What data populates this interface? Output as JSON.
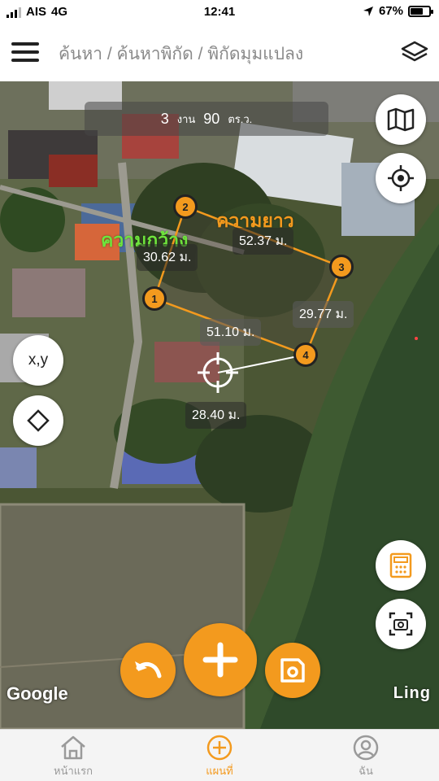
{
  "status_bar": {
    "carrier": "AIS",
    "network": "4G",
    "time": "12:41",
    "battery": "67%"
  },
  "header": {
    "breadcrumb": "ค้นหา / ค้นหาพิกัด / พิกัดมุมแปลง"
  },
  "map": {
    "area": {
      "value1": "3",
      "unit1": "งาน",
      "value2": "90",
      "unit2": "ตร.ว."
    },
    "length_title": "ความยาว",
    "width_title": "ความกว้าง",
    "edges": {
      "e23": "52.37 ม.",
      "e12": "30.62 ม.",
      "e34": "29.77 ม.",
      "e14": "51.10 ม.",
      "cursor": "28.40 ม."
    },
    "points": [
      "1",
      "2",
      "3",
      "4"
    ],
    "xy_button": "x,y",
    "attribution": "Google",
    "watermark": "Ling"
  },
  "colors": {
    "accent": "#f39a1e",
    "green_label": "#6ee33c"
  },
  "tabs": [
    {
      "label": "หน้าแรก",
      "icon": "home-icon"
    },
    {
      "label": "แผนที่",
      "icon": "plus-circle-icon",
      "active": true
    },
    {
      "label": "ฉัน",
      "icon": "user-icon"
    }
  ]
}
